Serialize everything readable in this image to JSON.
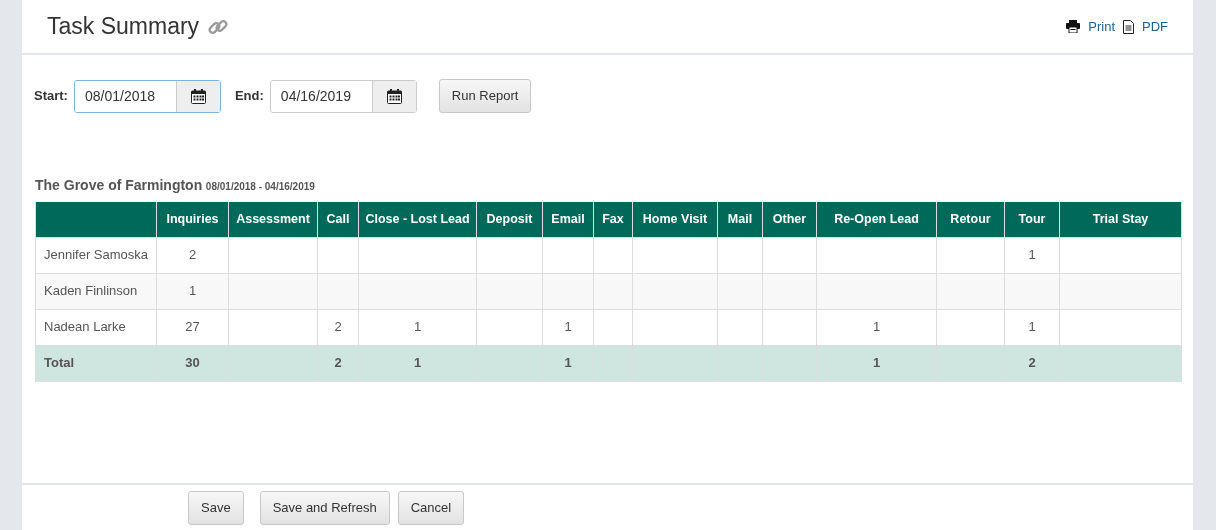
{
  "header": {
    "title": "Task Summary",
    "actions": [
      {
        "kind": "print",
        "label": "Print"
      },
      {
        "kind": "pdf",
        "label": "PDF"
      }
    ]
  },
  "filters": {
    "start": {
      "label": "Start:",
      "value": "08/01/2018",
      "focused": true
    },
    "end": {
      "label": "End:",
      "value": "04/16/2019",
      "focused": false
    },
    "run_button": "Run Report"
  },
  "report": {
    "title": "The Grove of Farmington",
    "range": "08/01/2018 - 04/16/2019",
    "table": {
      "columns": [
        "Inquiries",
        "Assessment",
        "Call",
        "Close - Lost Lead",
        "Deposit",
        "Email",
        "Fax",
        "Home Visit",
        "Mail",
        "Other",
        "Re-Open Lead",
        "Retour",
        "Tour",
        "Trial Stay"
      ],
      "rows": [
        {
          "kind": "person",
          "name": "Jennifer Samoska",
          "cells": [
            "2",
            null,
            null,
            null,
            null,
            null,
            null,
            null,
            null,
            null,
            null,
            null,
            "1",
            null
          ]
        },
        {
          "kind": "person",
          "name": "Kaden Finlinson",
          "cells": [
            "1",
            null,
            null,
            null,
            null,
            null,
            null,
            null,
            null,
            null,
            null,
            null,
            null,
            null
          ]
        },
        {
          "kind": "person",
          "name": "Nadean Larke",
          "cells": [
            "27",
            null,
            "2",
            "1",
            null,
            "1",
            null,
            null,
            null,
            null,
            "1",
            null,
            "1",
            null
          ]
        },
        {
          "kind": "total",
          "name": "Total",
          "cells": [
            "30",
            null,
            "2",
            "1",
            null,
            "1",
            null,
            null,
            null,
            null,
            "1",
            null,
            "2",
            null
          ]
        }
      ]
    }
  },
  "footer_buttons": [
    "Save",
    "Save and Refresh",
    "Cancel"
  ]
}
